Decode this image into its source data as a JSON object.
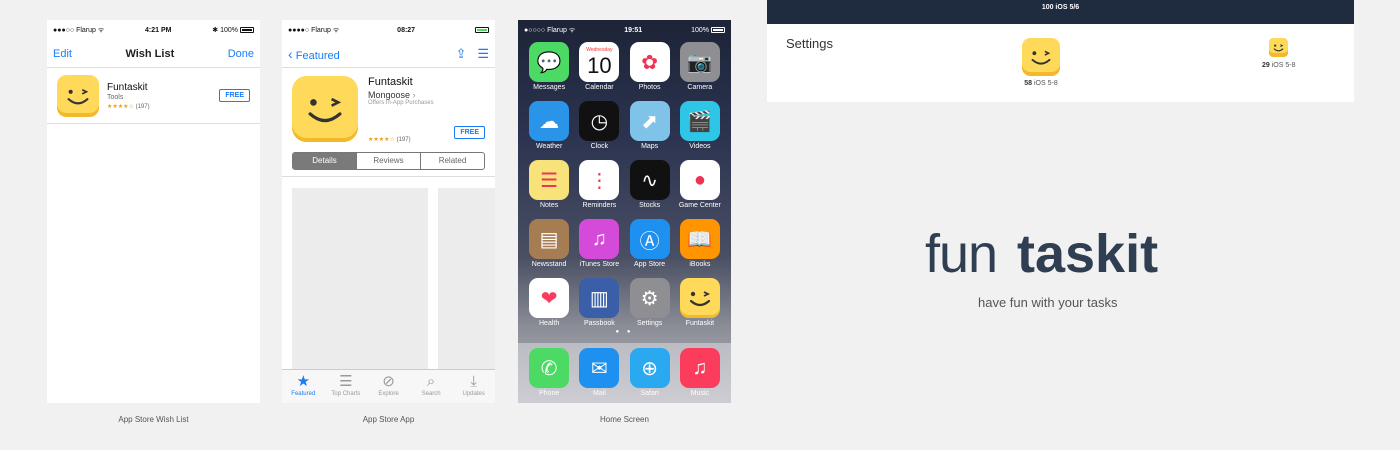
{
  "wishlist": {
    "status": {
      "carrier": "●●●○○ Flarup ᯤ",
      "time": "4:21 PM",
      "battery": "✱ 100%"
    },
    "nav": {
      "left": "Edit",
      "title": "Wish List",
      "right": "Done"
    },
    "item": {
      "name": "Funtaskit",
      "category": "Tools",
      "stars": "★★★★☆",
      "reviews": "(197)",
      "button": "FREE"
    },
    "caption": "App Store Wish List"
  },
  "appstore": {
    "status": {
      "carrier": "●●●●○ Flarup ᯤ",
      "time": "08:27"
    },
    "nav": {
      "back": "Featured"
    },
    "app": {
      "name": "Funtaskit",
      "publisher": "Mongoose",
      "iap": "Offers In-App Purchases",
      "stars": "★★★★☆",
      "reviews": "(197)",
      "button": "FREE"
    },
    "segments": [
      "Details",
      "Reviews",
      "Related"
    ],
    "tabs": [
      {
        "icon": "★",
        "label": "Featured"
      },
      {
        "icon": "☰",
        "label": "Top Charts"
      },
      {
        "icon": "⊘",
        "label": "Explore"
      },
      {
        "icon": "⌕",
        "label": "Search"
      },
      {
        "icon": "⤓",
        "label": "Updates"
      }
    ],
    "caption": "App Store App"
  },
  "home": {
    "status": {
      "carrier": "●○○○○ Flarup ᯤ",
      "time": "19:51",
      "battery": "100%"
    },
    "calendar": {
      "day": "Wednesday",
      "date": "10"
    },
    "apps": [
      {
        "label": "Messages",
        "color": "#4cd964",
        "glyph": "💬"
      },
      {
        "label": "Calendar",
        "color": "#ffffff",
        "glyph": ""
      },
      {
        "label": "Photos",
        "color": "#ffffff",
        "glyph": "✿"
      },
      {
        "label": "Camera",
        "color": "#8e8e93",
        "glyph": "📷"
      },
      {
        "label": "Weather",
        "color": "#2a95e8",
        "glyph": "☁"
      },
      {
        "label": "Clock",
        "color": "#111111",
        "glyph": "◷"
      },
      {
        "label": "Maps",
        "color": "#7fc4e8",
        "glyph": "⬈"
      },
      {
        "label": "Videos",
        "color": "#2ec6e6",
        "glyph": "🎬"
      },
      {
        "label": "Notes",
        "color": "#f8e27a",
        "glyph": "☰"
      },
      {
        "label": "Reminders",
        "color": "#ffffff",
        "glyph": "⋮"
      },
      {
        "label": "Stocks",
        "color": "#111111",
        "glyph": "∿"
      },
      {
        "label": "Game Center",
        "color": "#ffffff",
        "glyph": "●"
      },
      {
        "label": "Newsstand",
        "color": "#a67c52",
        "glyph": "▤"
      },
      {
        "label": "iTunes Store",
        "color": "#d44bd9",
        "glyph": "♫"
      },
      {
        "label": "App Store",
        "color": "#1e90f0",
        "glyph": "Ⓐ"
      },
      {
        "label": "iBooks",
        "color": "#ff9500",
        "glyph": "📖"
      },
      {
        "label": "Health",
        "color": "#ffffff",
        "glyph": "❤"
      },
      {
        "label": "Passbook",
        "color": "#3a5fa8",
        "glyph": "▥"
      },
      {
        "label": "Settings",
        "color": "#8e8e93",
        "glyph": "⚙"
      },
      {
        "label": "Funtaskit",
        "color": "#ffd95a",
        "glyph": ""
      }
    ],
    "dock": [
      {
        "label": "Phone",
        "color": "#4cd964",
        "glyph": "✆"
      },
      {
        "label": "Mail",
        "color": "#1e90f0",
        "glyph": "✉"
      },
      {
        "label": "Safari",
        "color": "#2aa8f0",
        "glyph": "⊕"
      },
      {
        "label": "Music",
        "color": "#fb3c5c",
        "glyph": "♫"
      }
    ],
    "caption": "Home Screen"
  },
  "ipad": {
    "topbar": "100 iOS 5/6",
    "settings": "Settings",
    "large": {
      "size": "58",
      "label": "iOS 5-8"
    },
    "small": {
      "size": "29",
      "label": "iOS 5-8"
    }
  },
  "brand": {
    "logo_light": "fun",
    "logo_bold": "taskit",
    "tagline": "have fun with your tasks"
  },
  "colors": {
    "accent": "#1a7cf9",
    "icon_yellow": "#ffd95a",
    "logo_navy": "#2f3e51"
  }
}
